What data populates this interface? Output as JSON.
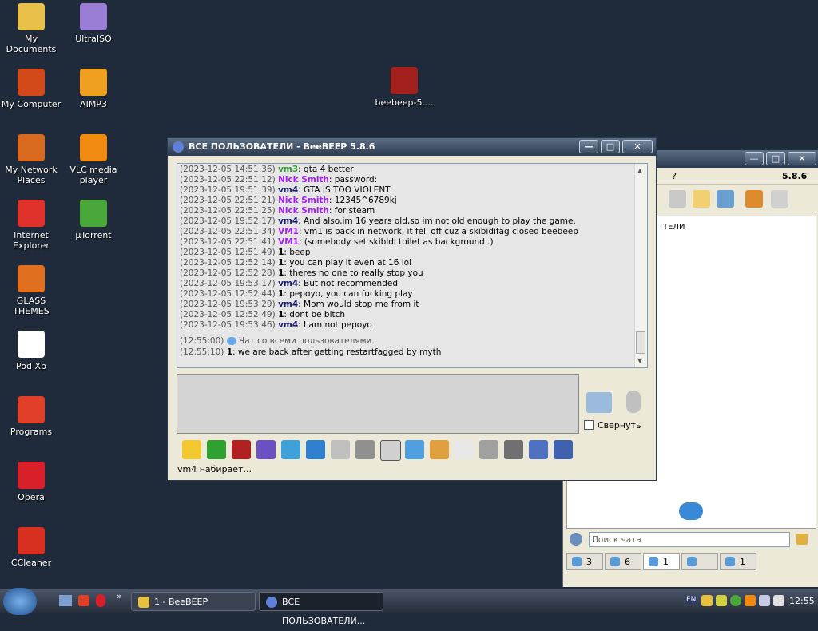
{
  "desktop": {
    "icons": [
      {
        "label": "My Documents",
        "color": "#e8c04a"
      },
      {
        "label": "UltraISO",
        "color": "#9a7ed6"
      },
      {
        "label": "My Computer",
        "color": "#d24a1a"
      },
      {
        "label": "AIMP3",
        "color": "#f0a020"
      },
      {
        "label": "My Network Places",
        "color": "#d86a20"
      },
      {
        "label": "VLC media player",
        "color": "#f08a10"
      },
      {
        "label": "Internet Explorer",
        "color": "#e0302a"
      },
      {
        "label": "µTorrent",
        "color": "#4aa83a"
      },
      {
        "label": "GLASS THEMES",
        "color": "#e07020"
      },
      {
        "label": "Pod Xp",
        "color": "#ffffff"
      },
      {
        "label": "Programs",
        "color": "#e04028"
      },
      {
        "label": "Opera",
        "color": "#d8202a"
      },
      {
        "label": "CCleaner",
        "color": "#d83020"
      },
      {
        "label": "beebeep-5....",
        "color": "#a4201c"
      }
    ]
  },
  "window": {
    "title": "ВСЕ ПОЛЬЗОВАТЕЛИ - BeeBEEP 5.8.6",
    "btn_minimize": "—",
    "btn_maximize": "□",
    "btn_close": "✕",
    "messages": [
      {
        "ts": "(2023-12-05 14:51:36)",
        "user": "vm3",
        "user_class": "u-green",
        "text": ": gta 4 better"
      },
      {
        "ts": "(2023-12-05 22:51:12)",
        "user": "Nick Smith",
        "user_class": "u-purple",
        "text": ": password:"
      },
      {
        "ts": "(2023-12-05 19:51:39)",
        "user": "vm4",
        "user_class": "u-navy",
        "text": ": GTA IS TOO VIOLENT"
      },
      {
        "ts": "(2023-12-05 22:51:21)",
        "user": "Nick Smith",
        "user_class": "u-purple",
        "text": ": 12345^6789kj"
      },
      {
        "ts": "(2023-12-05 22:51:25)",
        "user": "Nick Smith",
        "user_class": "u-purple",
        "text": ": for steam"
      },
      {
        "ts": "(2023-12-05 19:52:17)",
        "user": "vm4",
        "user_class": "u-navy",
        "text": ": And also,im 16 years old,so im not old enough to play the game."
      },
      {
        "ts": "(2023-12-05 22:51:34)",
        "user": "VM1",
        "user_class": "u-purple",
        "text": ": vm1 is back in network, it fell off cuz a skibidifag closed beebeep"
      },
      {
        "ts": "(2023-12-05 22:51:41)",
        "user": "VM1",
        "user_class": "u-purple",
        "text": ": (somebody set skibidi toilet as background..)"
      },
      {
        "ts": "(2023-12-05 12:51:49)",
        "user": "1",
        "user_class": "u-bold",
        "text": ": beep"
      },
      {
        "ts": "(2023-12-05 12:52:14)",
        "user": "1",
        "user_class": "u-bold",
        "text": ": you can play it even at 16 lol"
      },
      {
        "ts": "(2023-12-05 12:52:28)",
        "user": "1",
        "user_class": "u-bold",
        "text": ": theres no one to really stop you"
      },
      {
        "ts": "(2023-12-05 19:53:17)",
        "user": "vm4",
        "user_class": "u-navy",
        "text": ": But not recommended"
      },
      {
        "ts": "(2023-12-05 12:52:44)",
        "user": "1",
        "user_class": "u-bold",
        "text": ": pepoyo, you can fucking play"
      },
      {
        "ts": "(2023-12-05 19:53:29)",
        "user": "vm4",
        "user_class": "u-navy",
        "text": ": Mom would stop me from it"
      },
      {
        "ts": "(2023-12-05 12:52:49)",
        "user": "1",
        "user_class": "u-bold",
        "text": ": dont be bitch"
      },
      {
        "ts": "(2023-12-05 19:53:46)",
        "user": "vm4",
        "user_class": "u-navy",
        "text": ": I am not pepoyo"
      }
    ],
    "system_line": {
      "ts": "(12:55:00)",
      "text": "Чат со всеми пользователями."
    },
    "last_line": {
      "ts": "(12:55:10)",
      "user": "1",
      "text": ": we are back after getting restartfagged by myth"
    },
    "collapse_label": "Свернуть",
    "status_text": "vm4 набирает..."
  },
  "panel2": {
    "version": "5.8.6",
    "menu_help": "?",
    "list_title_partial": "ТЕЛИ",
    "search_placeholder": "Поиск чата",
    "tabs": [
      {
        "label": "3",
        "icon": "computer-icon"
      },
      {
        "label": "6",
        "icon": "users-icon"
      },
      {
        "label": "1",
        "icon": "chat-icon"
      },
      {
        "label": "",
        "icon": "groups-icon"
      },
      {
        "label": "1",
        "icon": "share-icon"
      }
    ]
  },
  "taskbar": {
    "task1": "1 - BeeBEEP",
    "task2": "ВСЕ ПОЛЬЗОВАТЕЛИ...",
    "lang": "EN",
    "clock": "12:55",
    "chevron": "»"
  }
}
